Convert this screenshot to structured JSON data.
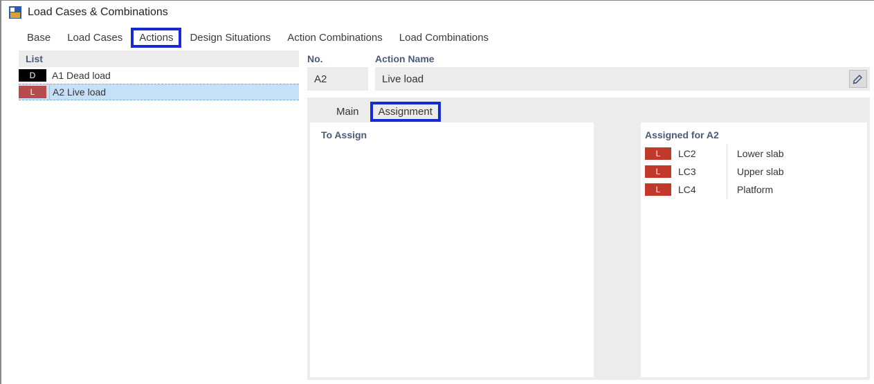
{
  "window": {
    "title": "Load Cases & Combinations"
  },
  "tabs": {
    "0": "Base",
    "1": "Load Cases",
    "2": "Actions",
    "3": "Design Situations",
    "4": "Action Combinations",
    "5": "Load Combinations",
    "selected": 2
  },
  "list": {
    "header": "List",
    "items": [
      {
        "badge": "D",
        "badgeColor": "black",
        "label": "A1 Dead load"
      },
      {
        "badge": "L",
        "badgeColor": "red",
        "label": "A2 Live load"
      }
    ],
    "selected": 1
  },
  "detail": {
    "no_label": "No.",
    "no_value": "A2",
    "name_label": "Action Name",
    "name_value": "Live load",
    "subtabs": {
      "0": "Main",
      "1": "Assignment",
      "selected": 1
    },
    "to_assign_label": "To Assign",
    "assigned_label": "Assigned for A2",
    "assigned": [
      {
        "badge": "L",
        "code": "LC2",
        "desc": "Lower slab"
      },
      {
        "badge": "L",
        "code": "LC3",
        "desc": "Upper slab"
      },
      {
        "badge": "L",
        "code": "LC4",
        "desc": "Platform"
      }
    ]
  }
}
